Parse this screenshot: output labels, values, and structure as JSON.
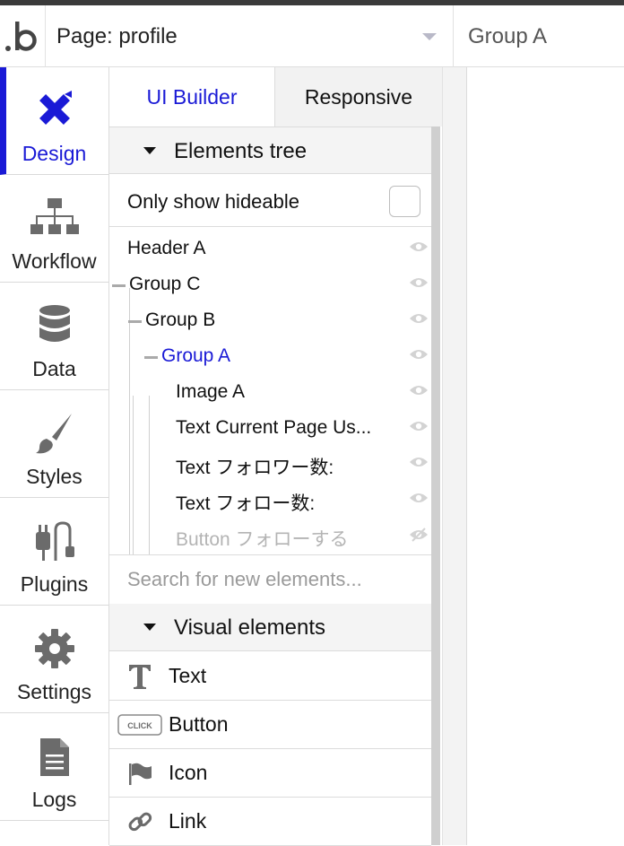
{
  "header": {
    "page_label": "Page: profile",
    "selected_element": "Group A"
  },
  "tabs": [
    {
      "label": "Design",
      "icon": "design-icon",
      "active": true
    },
    {
      "label": "Workflow",
      "icon": "workflow-icon",
      "active": false
    },
    {
      "label": "Data",
      "icon": "database-icon",
      "active": false
    },
    {
      "label": "Styles",
      "icon": "brush-icon",
      "active": false
    },
    {
      "label": "Plugins",
      "icon": "plug-icon",
      "active": false
    },
    {
      "label": "Settings",
      "icon": "gear-icon",
      "active": false
    },
    {
      "label": "Logs",
      "icon": "document-icon",
      "active": false
    }
  ],
  "panel": {
    "tab_ui": "UI Builder",
    "tab_responsive": "Responsive",
    "elements_tree_title": "Elements tree",
    "only_show_hideable": "Only show hideable",
    "tree": [
      {
        "label": "Header A",
        "depth": 0,
        "state": "normal"
      },
      {
        "label": "Group C",
        "depth": 0,
        "state": "normal"
      },
      {
        "label": "Group B",
        "depth": 1,
        "state": "normal"
      },
      {
        "label": "Group A",
        "depth": 2,
        "state": "selected"
      },
      {
        "label": "Image A",
        "depth": 3,
        "state": "normal"
      },
      {
        "label": "Text Current Page Us...",
        "depth": 3,
        "state": "normal"
      },
      {
        "label": "Text フォロワー数:",
        "depth": 3,
        "state": "normal"
      },
      {
        "label": "Text フォロー数:",
        "depth": 3,
        "state": "normal"
      },
      {
        "label": "Button フォローする",
        "depth": 3,
        "state": "hidden"
      }
    ],
    "search_placeholder": "Search for new elements...",
    "visual_elements_title": "Visual elements",
    "visual_elements": [
      {
        "label": "Text",
        "icon": "text-icon"
      },
      {
        "label": "Button",
        "icon": "button-click-icon",
        "icon_text": "CLICK"
      },
      {
        "label": "Icon",
        "icon": "flag-icon"
      },
      {
        "label": "Link",
        "icon": "link-icon"
      }
    ]
  },
  "colors": {
    "accent": "#1a1ad6",
    "icon_gray": "#6b6b6b",
    "hidden_text": "#b4b4b4"
  }
}
